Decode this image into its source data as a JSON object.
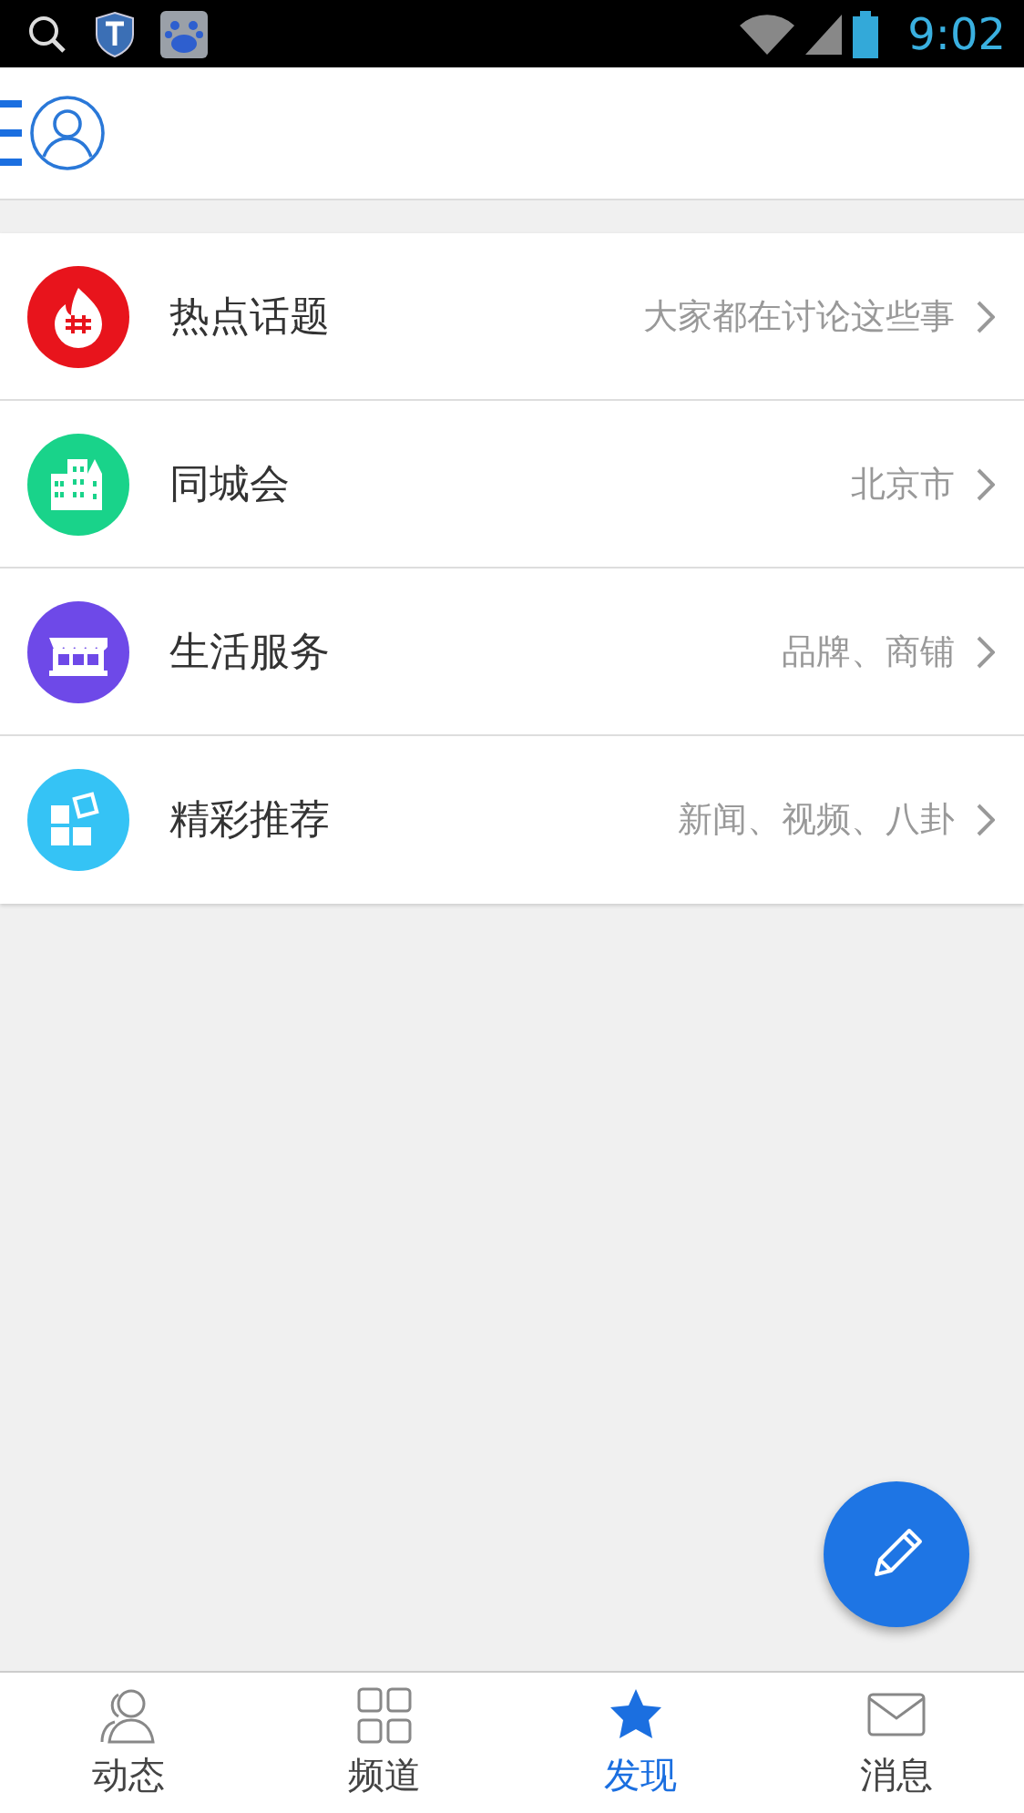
{
  "status_bar": {
    "time": "9:02"
  },
  "list": [
    {
      "kind": "fire",
      "color": "#e8141c",
      "title": "热点话题",
      "subtitle": "大家都在讨论这些事"
    },
    {
      "kind": "city",
      "color": "#19d38a",
      "title": "同城会",
      "subtitle": "北京市"
    },
    {
      "kind": "shop",
      "color": "#6e49e8",
      "title": "生活服务",
      "subtitle": "品牌、商铺"
    },
    {
      "kind": "tiles",
      "color": "#35c3f5",
      "title": "精彩推荐",
      "subtitle": "新闻、视频、八卦"
    }
  ],
  "bottom_nav": [
    {
      "kind": "people",
      "label": "动态",
      "selected": false
    },
    {
      "kind": "grid",
      "label": "频道",
      "selected": false
    },
    {
      "kind": "star",
      "label": "发现",
      "selected": true
    },
    {
      "kind": "mail",
      "label": "消息",
      "selected": false
    }
  ]
}
